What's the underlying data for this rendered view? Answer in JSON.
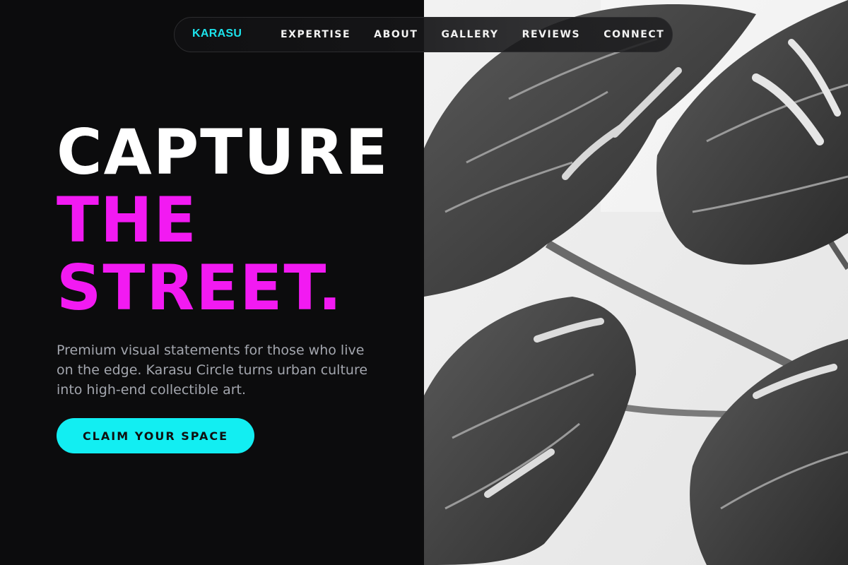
{
  "nav": {
    "brand": "KARASU",
    "links": [
      "EXPERTISE",
      "ABOUT",
      "GALLERY",
      "REVIEWS",
      "CONNECT"
    ]
  },
  "hero": {
    "title_lines": [
      "CAPTURE",
      "THE",
      "STREET."
    ],
    "description": "Premium visual statements for those who live on the edge. Karasu Circle turns urban culture into high-end collectible art.",
    "cta_label": "CLAIM YOUR SPACE"
  },
  "image": {
    "subject": "monstera-leaves-photo",
    "style": "black-and-white"
  },
  "colors": {
    "background": "#0c0c0d",
    "brand_accent": "#1ce3ec",
    "headline_white": "#ffffff",
    "headline_magenta": "#f21af2",
    "body_text": "#a3a6ae",
    "cta_background": "#12eef2",
    "cta_text": "#101010"
  }
}
